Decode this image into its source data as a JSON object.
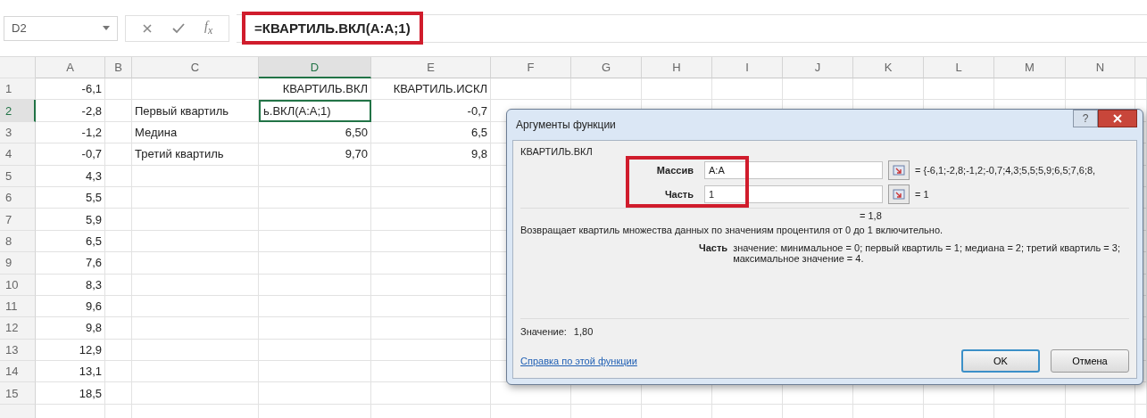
{
  "formula_bar": {
    "name_box": "D2",
    "insert_function": "f$_{x}$",
    "formula": "=КВАРТИЛЬ.ВКЛ(A:A;1)",
    "highlighted": true
  },
  "columns": [
    {
      "label": "A",
      "selected": false
    },
    {
      "label": "B",
      "selected": false
    },
    {
      "label": "C",
      "selected": false
    },
    {
      "label": "D",
      "selected": true
    },
    {
      "label": "E",
      "selected": false
    },
    {
      "label": "F",
      "selected": false
    },
    {
      "label": "G",
      "selected": false
    },
    {
      "label": "H",
      "selected": false
    },
    {
      "label": "I",
      "selected": false
    },
    {
      "label": "J",
      "selected": false
    },
    {
      "label": "K",
      "selected": false
    },
    {
      "label": "L",
      "selected": false
    },
    {
      "label": "M",
      "selected": false
    },
    {
      "label": "N",
      "selected": false
    }
  ],
  "rows": [
    {
      "number": "1",
      "selected": false,
      "a": "-6,1",
      "d": "КВАРТИЛЬ.ВКЛ",
      "e": "КВАРТИЛЬ.ИСКЛ"
    },
    {
      "number": "2",
      "selected": true,
      "a": "-2,8",
      "c": "Первый квартиль",
      "d": "ь.ВКЛ(A:A;1)",
      "e": "-0,7"
    },
    {
      "number": "3",
      "selected": false,
      "a": "-1,2",
      "c": "Медина",
      "d": "6,50",
      "e": "6,5"
    },
    {
      "number": "4",
      "selected": false,
      "a": "-0,7",
      "c": "Третий квартиль",
      "d": "9,70",
      "e": "9,8"
    },
    {
      "number": "5",
      "selected": false,
      "a": "4,3"
    },
    {
      "number": "6",
      "selected": false,
      "a": "5,5"
    },
    {
      "number": "7",
      "selected": false,
      "a": "5,9"
    },
    {
      "number": "8",
      "selected": false,
      "a": "6,5"
    },
    {
      "number": "9",
      "selected": false,
      "a": "7,6"
    },
    {
      "number": "10",
      "selected": false,
      "a": "8,3"
    },
    {
      "number": "11",
      "selected": false,
      "a": "9,6"
    },
    {
      "number": "12",
      "selected": false,
      "a": "9,8"
    },
    {
      "number": "13",
      "selected": false,
      "a": "12,9"
    },
    {
      "number": "14",
      "selected": false,
      "a": "13,1"
    },
    {
      "number": "15",
      "selected": false,
      "a": "18,5"
    }
  ],
  "dialog": {
    "title": "Аргументы функции",
    "help": "?",
    "function_name": "КВАРТИЛЬ.ВКЛ",
    "arguments_highlighted": true,
    "arguments": [
      {
        "label": "Массив",
        "value": "A:A",
        "result": "= {-6,1;-2,8;-1,2;-0,7;4,3;5,5;5,9;6,5;7,6;8,"
      },
      {
        "label": "Часть",
        "value": "1",
        "result": "= 1"
      }
    ],
    "formula_result": "= 1,8",
    "description": "Возвращает квартиль множества данных по значениям процентиля от 0 до 1 включительно.",
    "argument_help_label": "Часть",
    "argument_help": "значение: минимальное = 0; первый квартиль = 1; медиана = 2; третий квартиль = 3; максимальное значение = 4.",
    "value_label": "Значение:",
    "value": "1,80",
    "help_link": "Справка по этой функции",
    "buttons": [
      "OK",
      "Отмена"
    ]
  }
}
